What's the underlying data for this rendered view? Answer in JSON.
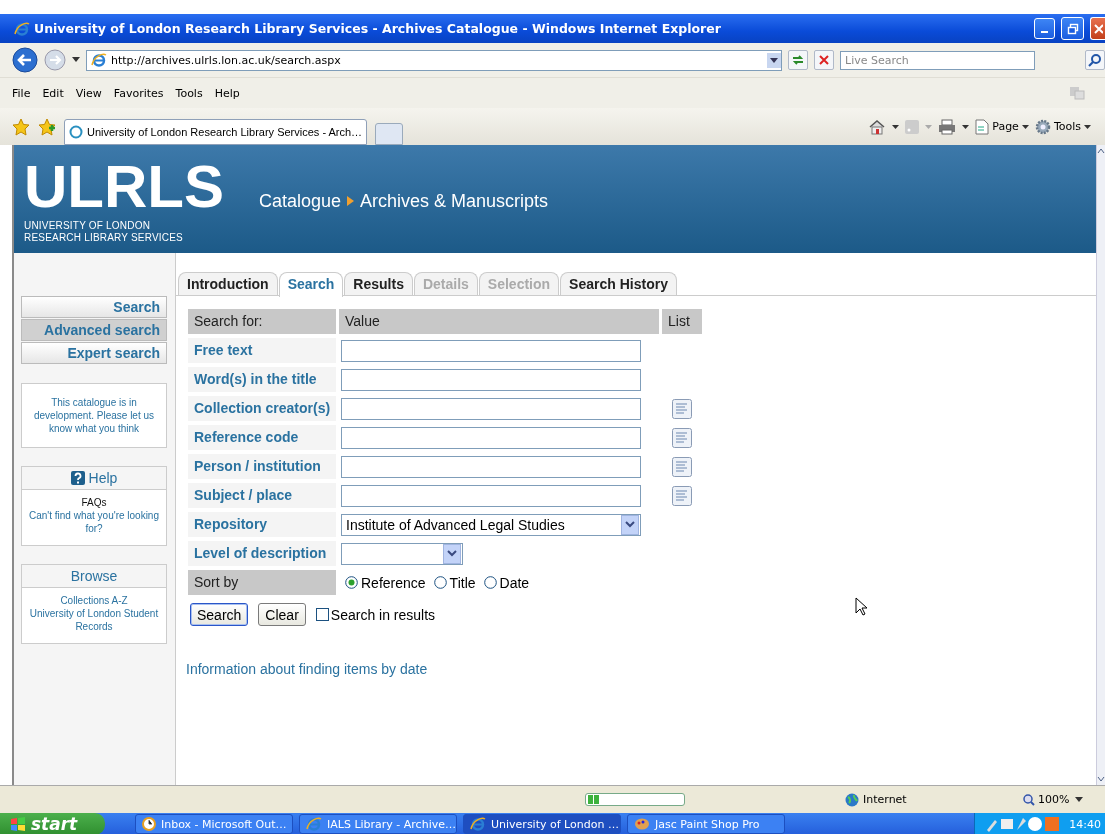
{
  "window": {
    "title": "University of London Research Library Services - Archives Catalogue - Windows Internet Explorer"
  },
  "address_bar": {
    "url": "http://archives.ulrls.lon.ac.uk/search.aspx",
    "search_placeholder": "Live Search"
  },
  "menu": [
    "File",
    "Edit",
    "View",
    "Favorites",
    "Tools",
    "Help"
  ],
  "browser_tabs": [
    {
      "label": "University of London Research Library Services - Arch…",
      "selected": true
    }
  ],
  "command_bar": [
    "Page",
    "Tools"
  ],
  "site": {
    "logo": {
      "letters": "ULRLS",
      "line1": "UNIVERSITY OF LONDON",
      "line2": "RESEARCH LIBRARY SERVICES"
    },
    "breadcrumb": [
      "Catalogue",
      "Archives & Manuscripts"
    ]
  },
  "page_tabs": [
    {
      "label": "Introduction",
      "selected": false,
      "disabled": false
    },
    {
      "label": "Search",
      "selected": true,
      "disabled": false
    },
    {
      "label": "Results",
      "selected": false,
      "disabled": false
    },
    {
      "label": "Details",
      "selected": false,
      "disabled": true
    },
    {
      "label": "Selection",
      "selected": false,
      "disabled": true
    },
    {
      "label": "Search History",
      "selected": false,
      "disabled": false
    }
  ],
  "sidebar": {
    "nav": [
      {
        "label": "Search",
        "selected": false
      },
      {
        "label": "Advanced search",
        "selected": true
      },
      {
        "label": "Expert search",
        "selected": false
      }
    ],
    "notice": "This catalogue is in development. Please let us know what you think",
    "help": {
      "title": "Help",
      "items": [
        {
          "label": "FAQs",
          "kind": "text"
        },
        {
          "label": "Can't find what you're looking for?",
          "kind": "link"
        }
      ]
    },
    "browse": {
      "title": "Browse",
      "items": [
        {
          "label": "Collections A-Z",
          "kind": "link"
        },
        {
          "label": "University of London Student Records",
          "kind": "link"
        }
      ]
    }
  },
  "form": {
    "headers": [
      "Search for:",
      "Value",
      "List"
    ],
    "fields": [
      {
        "label": "Free text",
        "kind": "text",
        "list": false
      },
      {
        "label": "Word(s) in the title",
        "kind": "text",
        "list": false
      },
      {
        "label": "Collection creator(s)",
        "kind": "text",
        "list": true
      },
      {
        "label": "Reference code",
        "kind": "text",
        "list": true
      },
      {
        "label": "Person / institution",
        "kind": "text",
        "list": true
      },
      {
        "label": "Subject / place",
        "kind": "text",
        "list": true
      },
      {
        "label": "Repository",
        "kind": "select",
        "value": "Institute of Advanced Legal Studies",
        "list": false
      },
      {
        "label": "Level of description",
        "kind": "small-select",
        "list": false
      }
    ],
    "sort": {
      "label": "Sort by",
      "options": [
        {
          "label": "Reference",
          "selected": true
        },
        {
          "label": "Title",
          "selected": false
        },
        {
          "label": "Date",
          "selected": false
        }
      ]
    },
    "buttons": [
      "Search",
      "Clear"
    ],
    "search_in_results": {
      "label": "Search in results",
      "checked": false
    }
  },
  "info_link": "Information about finding items by date",
  "status_bar": {
    "progress": {
      "level": 0.12
    },
    "zone": "Internet",
    "zoom": "100%"
  },
  "taskbar": {
    "start": "start",
    "tasks": [
      {
        "label": "Inbox - Microsoft Out…",
        "selected": false
      },
      {
        "label": "IALS Library - Archive…",
        "selected": false
      },
      {
        "label": "University of London …",
        "selected": true
      },
      {
        "label": "Jasc Paint Shop Pro",
        "selected": false
      }
    ],
    "clock": "14:40"
  }
}
